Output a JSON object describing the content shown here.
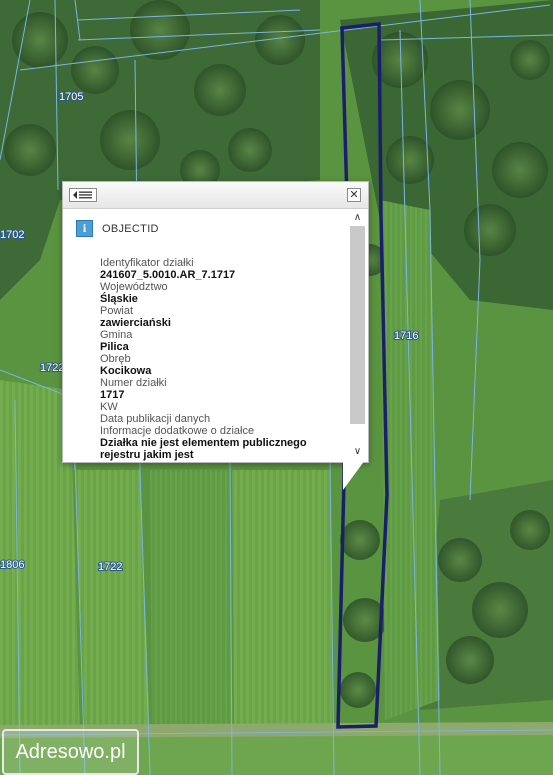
{
  "map": {
    "parcel_labels": [
      "1705",
      "1702",
      "1716",
      "1722",
      "1722",
      "1806"
    ]
  },
  "popup": {
    "title": "OBJECTID",
    "attributes": [
      {
        "label": "Identyfikator działki",
        "value": "241607_5.0010.AR_7.1717"
      },
      {
        "label": "Województwo",
        "value": "Śląskie"
      },
      {
        "label": "Powiat",
        "value": "zawierciański"
      },
      {
        "label": "Gmina",
        "value": "Pilica"
      },
      {
        "label": "Obręb",
        "value": "Kocikowa"
      },
      {
        "label": "Numer działki",
        "value": "1717"
      },
      {
        "label": "KW",
        "value": ""
      },
      {
        "label": "Data publikacji danych",
        "value": ""
      },
      {
        "label": "Informacje dodatkowe o działce",
        "value": "Działka nie jest elementem publicznego rejestru jakim jest"
      }
    ]
  },
  "brand": {
    "text": "Adresowo.pl"
  },
  "colors": {
    "parcel_outline": "#1b1f6b",
    "parcel_lines": "#7fb5e0",
    "field_green": "#5a9440",
    "forest": "#2f5a2c"
  }
}
